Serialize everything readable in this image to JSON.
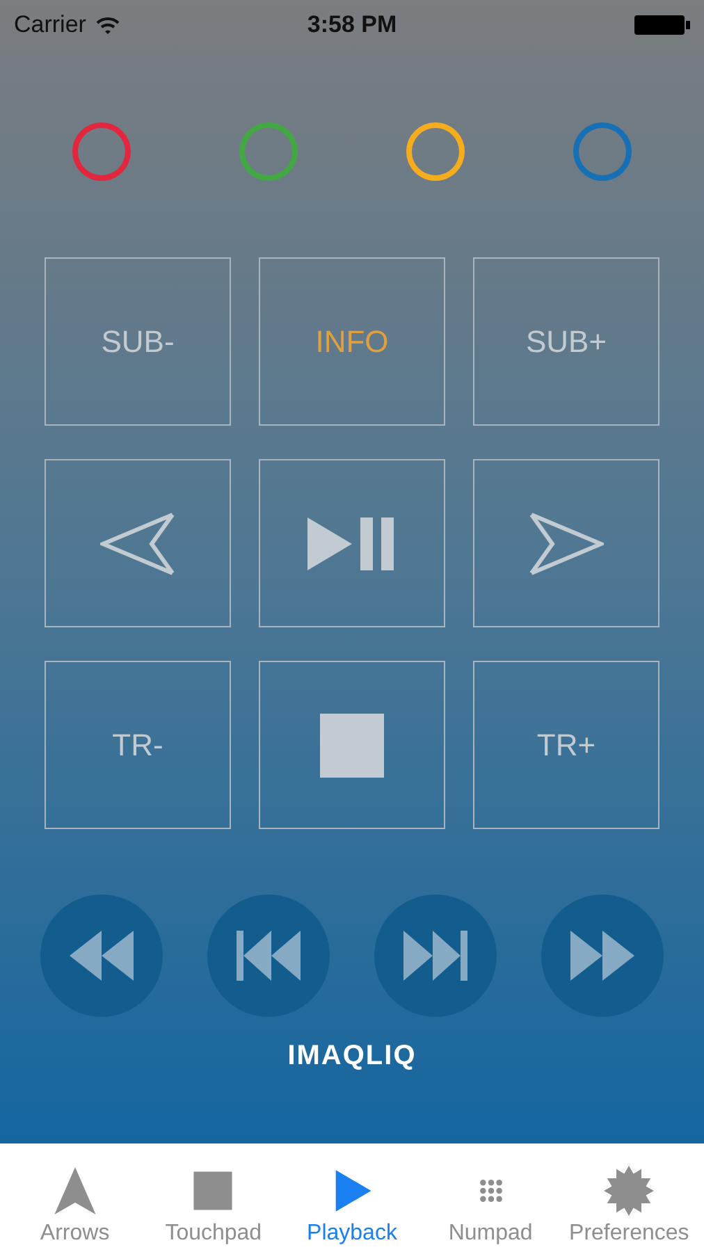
{
  "status_bar": {
    "carrier": "Carrier",
    "time": "3:58 PM"
  },
  "color_buttons": [
    {
      "color": "#e2263e"
    },
    {
      "color": "#43a843"
    },
    {
      "color": "#f5ad1e"
    },
    {
      "color": "#1670b5"
    }
  ],
  "grid_buttons": [
    {
      "kind": "text",
      "label": "SUB-",
      "highlighted": false
    },
    {
      "kind": "text",
      "label": "INFO",
      "highlighted": true
    },
    {
      "kind": "text",
      "label": "SUB+",
      "highlighted": false
    },
    {
      "kind": "back"
    },
    {
      "kind": "playpause"
    },
    {
      "kind": "forward"
    },
    {
      "kind": "text",
      "label": "TR-",
      "highlighted": false
    },
    {
      "kind": "stop"
    },
    {
      "kind": "text",
      "label": "TR+",
      "highlighted": false
    }
  ],
  "transport_buttons": [
    {
      "kind": "rewind"
    },
    {
      "kind": "previous"
    },
    {
      "kind": "next"
    },
    {
      "kind": "fastforward"
    }
  ],
  "brand": "IMAQLIQ",
  "tabs": [
    {
      "kind": "arrows",
      "label": "Arrows",
      "selected": false
    },
    {
      "kind": "touchpad",
      "label": "Touchpad",
      "selected": false
    },
    {
      "kind": "playback",
      "label": "Playback",
      "selected": true
    },
    {
      "kind": "numpad",
      "label": "Numpad",
      "selected": false
    },
    {
      "kind": "preferences",
      "label": "Preferences",
      "selected": false
    }
  ]
}
